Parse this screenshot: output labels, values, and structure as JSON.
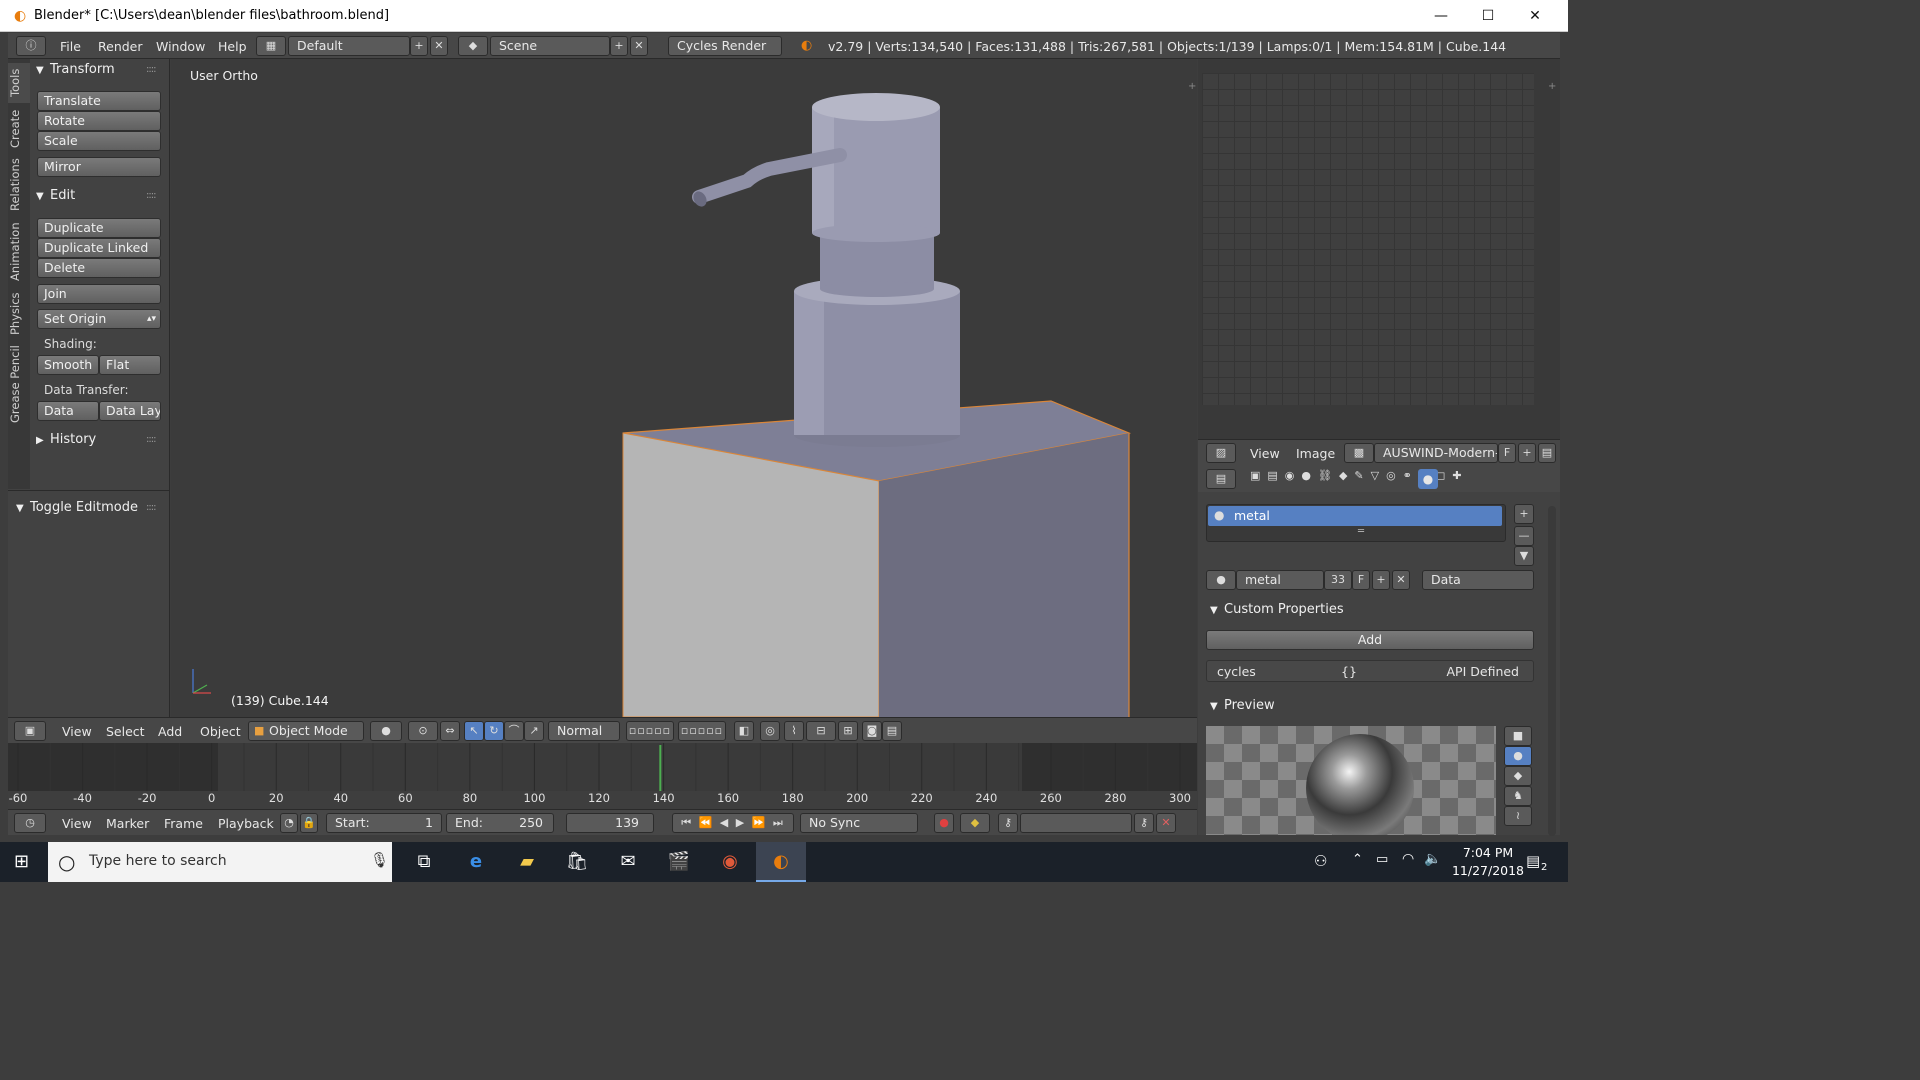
{
  "window": {
    "title": "Blender* [C:\\Users\\dean\\blender files\\bathroom.blend]",
    "minimize": "—",
    "maximize": "☐",
    "close": "✕"
  },
  "topbar": {
    "info_icon": "ⓘ",
    "menus": [
      "File",
      "Render",
      "Window",
      "Help"
    ],
    "layout": "Default",
    "scene": "Scene",
    "engine": "Cycles Render",
    "stats": "v2.79 | Verts:134,540 | Faces:131,488 | Tris:267,581 | Objects:1/139 | Lamps:0/1 | Mem:154.81M | Cube.144"
  },
  "toolshelf": {
    "tabs": [
      "Tools",
      "Create",
      "Relations",
      "Animation",
      "Physics",
      "Grease Pencil"
    ],
    "transform_header": "Transform",
    "translate": "Translate",
    "rotate": "Rotate",
    "scale": "Scale",
    "mirror": "Mirror",
    "edit_header": "Edit",
    "duplicate": "Duplicate",
    "duplicate_linked": "Duplicate Linked",
    "delete": "Delete",
    "join": "Join",
    "set_origin": "Set Origin",
    "shading_label": "Shading:",
    "smooth": "Smooth",
    "flat": "Flat",
    "data_transfer_label": "Data Transfer:",
    "data": "Data",
    "data_lay": "Data Lay",
    "history_header": "History",
    "toggle_editmode_header": "Toggle Editmode"
  },
  "viewport": {
    "view_label": "User Ortho",
    "object_label": "(139) Cube.144"
  },
  "viewport_header": {
    "menus": [
      "View",
      "Select",
      "Add",
      "Object"
    ],
    "mode": "Object Mode",
    "orientation": "Normal"
  },
  "timeline": {
    "ticks": [
      "-60",
      "-40",
      "-20",
      "0",
      "20",
      "40",
      "60",
      "80",
      "100",
      "120",
      "140",
      "160",
      "180",
      "200",
      "220",
      "240",
      "260",
      "280",
      "300"
    ],
    "current_frame_marker": 139
  },
  "timeline_header": {
    "menus": [
      "View",
      "Marker",
      "Frame",
      "Playback"
    ],
    "start_label": "Start:",
    "start_value": "1",
    "end_label": "End:",
    "end_value": "250",
    "current_frame": "139",
    "sync": "No Sync"
  },
  "image_editor": {
    "menus": [
      "View",
      "Image"
    ],
    "image_name": "AUSWIND-Modern-...",
    "fake_user": "F"
  },
  "properties": {
    "material_slot": "metal",
    "material_name": "metal",
    "users": "33",
    "fake_user": "F",
    "link": "Data",
    "custom_properties_header": "Custom Properties",
    "add_button": "Add",
    "prop_name": "cycles",
    "prop_value": "{}",
    "prop_type": "API Defined",
    "preview_header": "Preview"
  },
  "taskbar": {
    "search_placeholder": "Type here to search",
    "time": "7:04 PM",
    "date": "11/27/2018",
    "notifications": "2"
  }
}
